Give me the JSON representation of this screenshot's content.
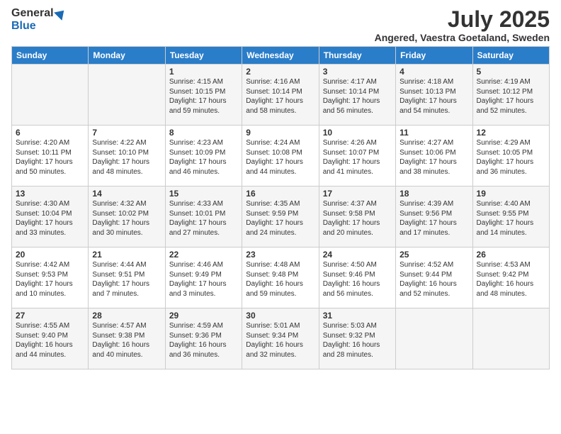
{
  "header": {
    "logo_line1": "General",
    "logo_line2": "Blue",
    "title": "July 2025",
    "subtitle": "Angered, Vaestra Goetaland, Sweden"
  },
  "days_of_week": [
    "Sunday",
    "Monday",
    "Tuesday",
    "Wednesday",
    "Thursday",
    "Friday",
    "Saturday"
  ],
  "weeks": [
    [
      {
        "day": "",
        "info": ""
      },
      {
        "day": "",
        "info": ""
      },
      {
        "day": "1",
        "info": "Sunrise: 4:15 AM\nSunset: 10:15 PM\nDaylight: 17 hours and 59 minutes."
      },
      {
        "day": "2",
        "info": "Sunrise: 4:16 AM\nSunset: 10:14 PM\nDaylight: 17 hours and 58 minutes."
      },
      {
        "day": "3",
        "info": "Sunrise: 4:17 AM\nSunset: 10:14 PM\nDaylight: 17 hours and 56 minutes."
      },
      {
        "day": "4",
        "info": "Sunrise: 4:18 AM\nSunset: 10:13 PM\nDaylight: 17 hours and 54 minutes."
      },
      {
        "day": "5",
        "info": "Sunrise: 4:19 AM\nSunset: 10:12 PM\nDaylight: 17 hours and 52 minutes."
      }
    ],
    [
      {
        "day": "6",
        "info": "Sunrise: 4:20 AM\nSunset: 10:11 PM\nDaylight: 17 hours and 50 minutes."
      },
      {
        "day": "7",
        "info": "Sunrise: 4:22 AM\nSunset: 10:10 PM\nDaylight: 17 hours and 48 minutes."
      },
      {
        "day": "8",
        "info": "Sunrise: 4:23 AM\nSunset: 10:09 PM\nDaylight: 17 hours and 46 minutes."
      },
      {
        "day": "9",
        "info": "Sunrise: 4:24 AM\nSunset: 10:08 PM\nDaylight: 17 hours and 44 minutes."
      },
      {
        "day": "10",
        "info": "Sunrise: 4:26 AM\nSunset: 10:07 PM\nDaylight: 17 hours and 41 minutes."
      },
      {
        "day": "11",
        "info": "Sunrise: 4:27 AM\nSunset: 10:06 PM\nDaylight: 17 hours and 38 minutes."
      },
      {
        "day": "12",
        "info": "Sunrise: 4:29 AM\nSunset: 10:05 PM\nDaylight: 17 hours and 36 minutes."
      }
    ],
    [
      {
        "day": "13",
        "info": "Sunrise: 4:30 AM\nSunset: 10:04 PM\nDaylight: 17 hours and 33 minutes."
      },
      {
        "day": "14",
        "info": "Sunrise: 4:32 AM\nSunset: 10:02 PM\nDaylight: 17 hours and 30 minutes."
      },
      {
        "day": "15",
        "info": "Sunrise: 4:33 AM\nSunset: 10:01 PM\nDaylight: 17 hours and 27 minutes."
      },
      {
        "day": "16",
        "info": "Sunrise: 4:35 AM\nSunset: 9:59 PM\nDaylight: 17 hours and 24 minutes."
      },
      {
        "day": "17",
        "info": "Sunrise: 4:37 AM\nSunset: 9:58 PM\nDaylight: 17 hours and 20 minutes."
      },
      {
        "day": "18",
        "info": "Sunrise: 4:39 AM\nSunset: 9:56 PM\nDaylight: 17 hours and 17 minutes."
      },
      {
        "day": "19",
        "info": "Sunrise: 4:40 AM\nSunset: 9:55 PM\nDaylight: 17 hours and 14 minutes."
      }
    ],
    [
      {
        "day": "20",
        "info": "Sunrise: 4:42 AM\nSunset: 9:53 PM\nDaylight: 17 hours and 10 minutes."
      },
      {
        "day": "21",
        "info": "Sunrise: 4:44 AM\nSunset: 9:51 PM\nDaylight: 17 hours and 7 minutes."
      },
      {
        "day": "22",
        "info": "Sunrise: 4:46 AM\nSunset: 9:49 PM\nDaylight: 17 hours and 3 minutes."
      },
      {
        "day": "23",
        "info": "Sunrise: 4:48 AM\nSunset: 9:48 PM\nDaylight: 16 hours and 59 minutes."
      },
      {
        "day": "24",
        "info": "Sunrise: 4:50 AM\nSunset: 9:46 PM\nDaylight: 16 hours and 56 minutes."
      },
      {
        "day": "25",
        "info": "Sunrise: 4:52 AM\nSunset: 9:44 PM\nDaylight: 16 hours and 52 minutes."
      },
      {
        "day": "26",
        "info": "Sunrise: 4:53 AM\nSunset: 9:42 PM\nDaylight: 16 hours and 48 minutes."
      }
    ],
    [
      {
        "day": "27",
        "info": "Sunrise: 4:55 AM\nSunset: 9:40 PM\nDaylight: 16 hours and 44 minutes."
      },
      {
        "day": "28",
        "info": "Sunrise: 4:57 AM\nSunset: 9:38 PM\nDaylight: 16 hours and 40 minutes."
      },
      {
        "day": "29",
        "info": "Sunrise: 4:59 AM\nSunset: 9:36 PM\nDaylight: 16 hours and 36 minutes."
      },
      {
        "day": "30",
        "info": "Sunrise: 5:01 AM\nSunset: 9:34 PM\nDaylight: 16 hours and 32 minutes."
      },
      {
        "day": "31",
        "info": "Sunrise: 5:03 AM\nSunset: 9:32 PM\nDaylight: 16 hours and 28 minutes."
      },
      {
        "day": "",
        "info": ""
      },
      {
        "day": "",
        "info": ""
      }
    ]
  ]
}
